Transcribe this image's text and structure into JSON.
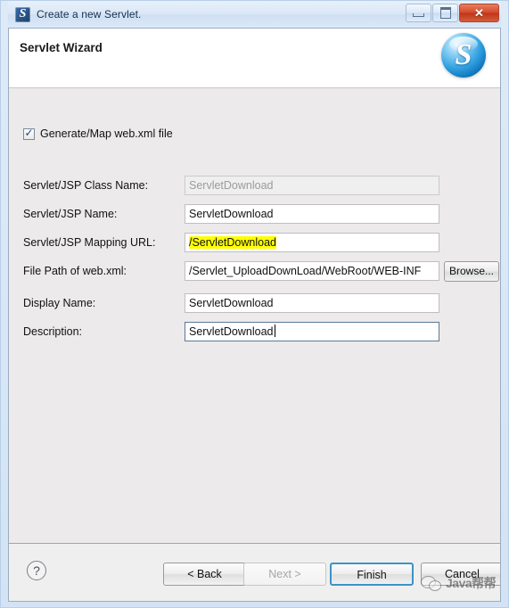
{
  "window": {
    "title": "Create a new Servlet.",
    "icon": "servlet-app-icon",
    "controls": {
      "minimize": "minimize-icon",
      "maximize": "maximize-icon",
      "close": "✕"
    }
  },
  "banner": {
    "title": "Servlet Wizard",
    "logo": "S"
  },
  "content": {
    "checkbox": {
      "label": "Generate/Map web.xml file",
      "checked": true
    },
    "fields": [
      {
        "label": "Servlet/JSP Class Name:",
        "value": "ServletDownload",
        "disabled": true,
        "highlighted": false,
        "focused": false
      },
      {
        "label": "Servlet/JSP Name:",
        "value": "ServletDownload",
        "disabled": false,
        "highlighted": false,
        "focused": false
      },
      {
        "label": "Servlet/JSP Mapping URL:",
        "value": "/ServletDownload",
        "disabled": false,
        "highlighted": true,
        "focused": false
      },
      {
        "label": "File Path of web.xml:",
        "value": "/Servlet_UploadDownLoad/WebRoot/WEB-INF",
        "disabled": false,
        "highlighted": false,
        "focused": false,
        "browse_label": "Browse..."
      },
      {
        "label": "Display Name:",
        "value": "ServletDownload",
        "disabled": false,
        "highlighted": false,
        "focused": false
      },
      {
        "label": "Description:",
        "value": "ServletDownload",
        "disabled": false,
        "highlighted": false,
        "focused": true
      }
    ]
  },
  "buttonbar": {
    "help": "?",
    "back": "< Back",
    "next": "Next >",
    "finish": "Finish",
    "cancel": "Cancel"
  },
  "watermark": {
    "text": "Java帮帮",
    "logo": "wechat-icon"
  },
  "colors": {
    "highlight": "#ffff00",
    "default_button_outline": "#3c93c6",
    "close_button": "#c6452a",
    "window_border": "#b6cfe8",
    "content_bg": "#eceaea"
  }
}
